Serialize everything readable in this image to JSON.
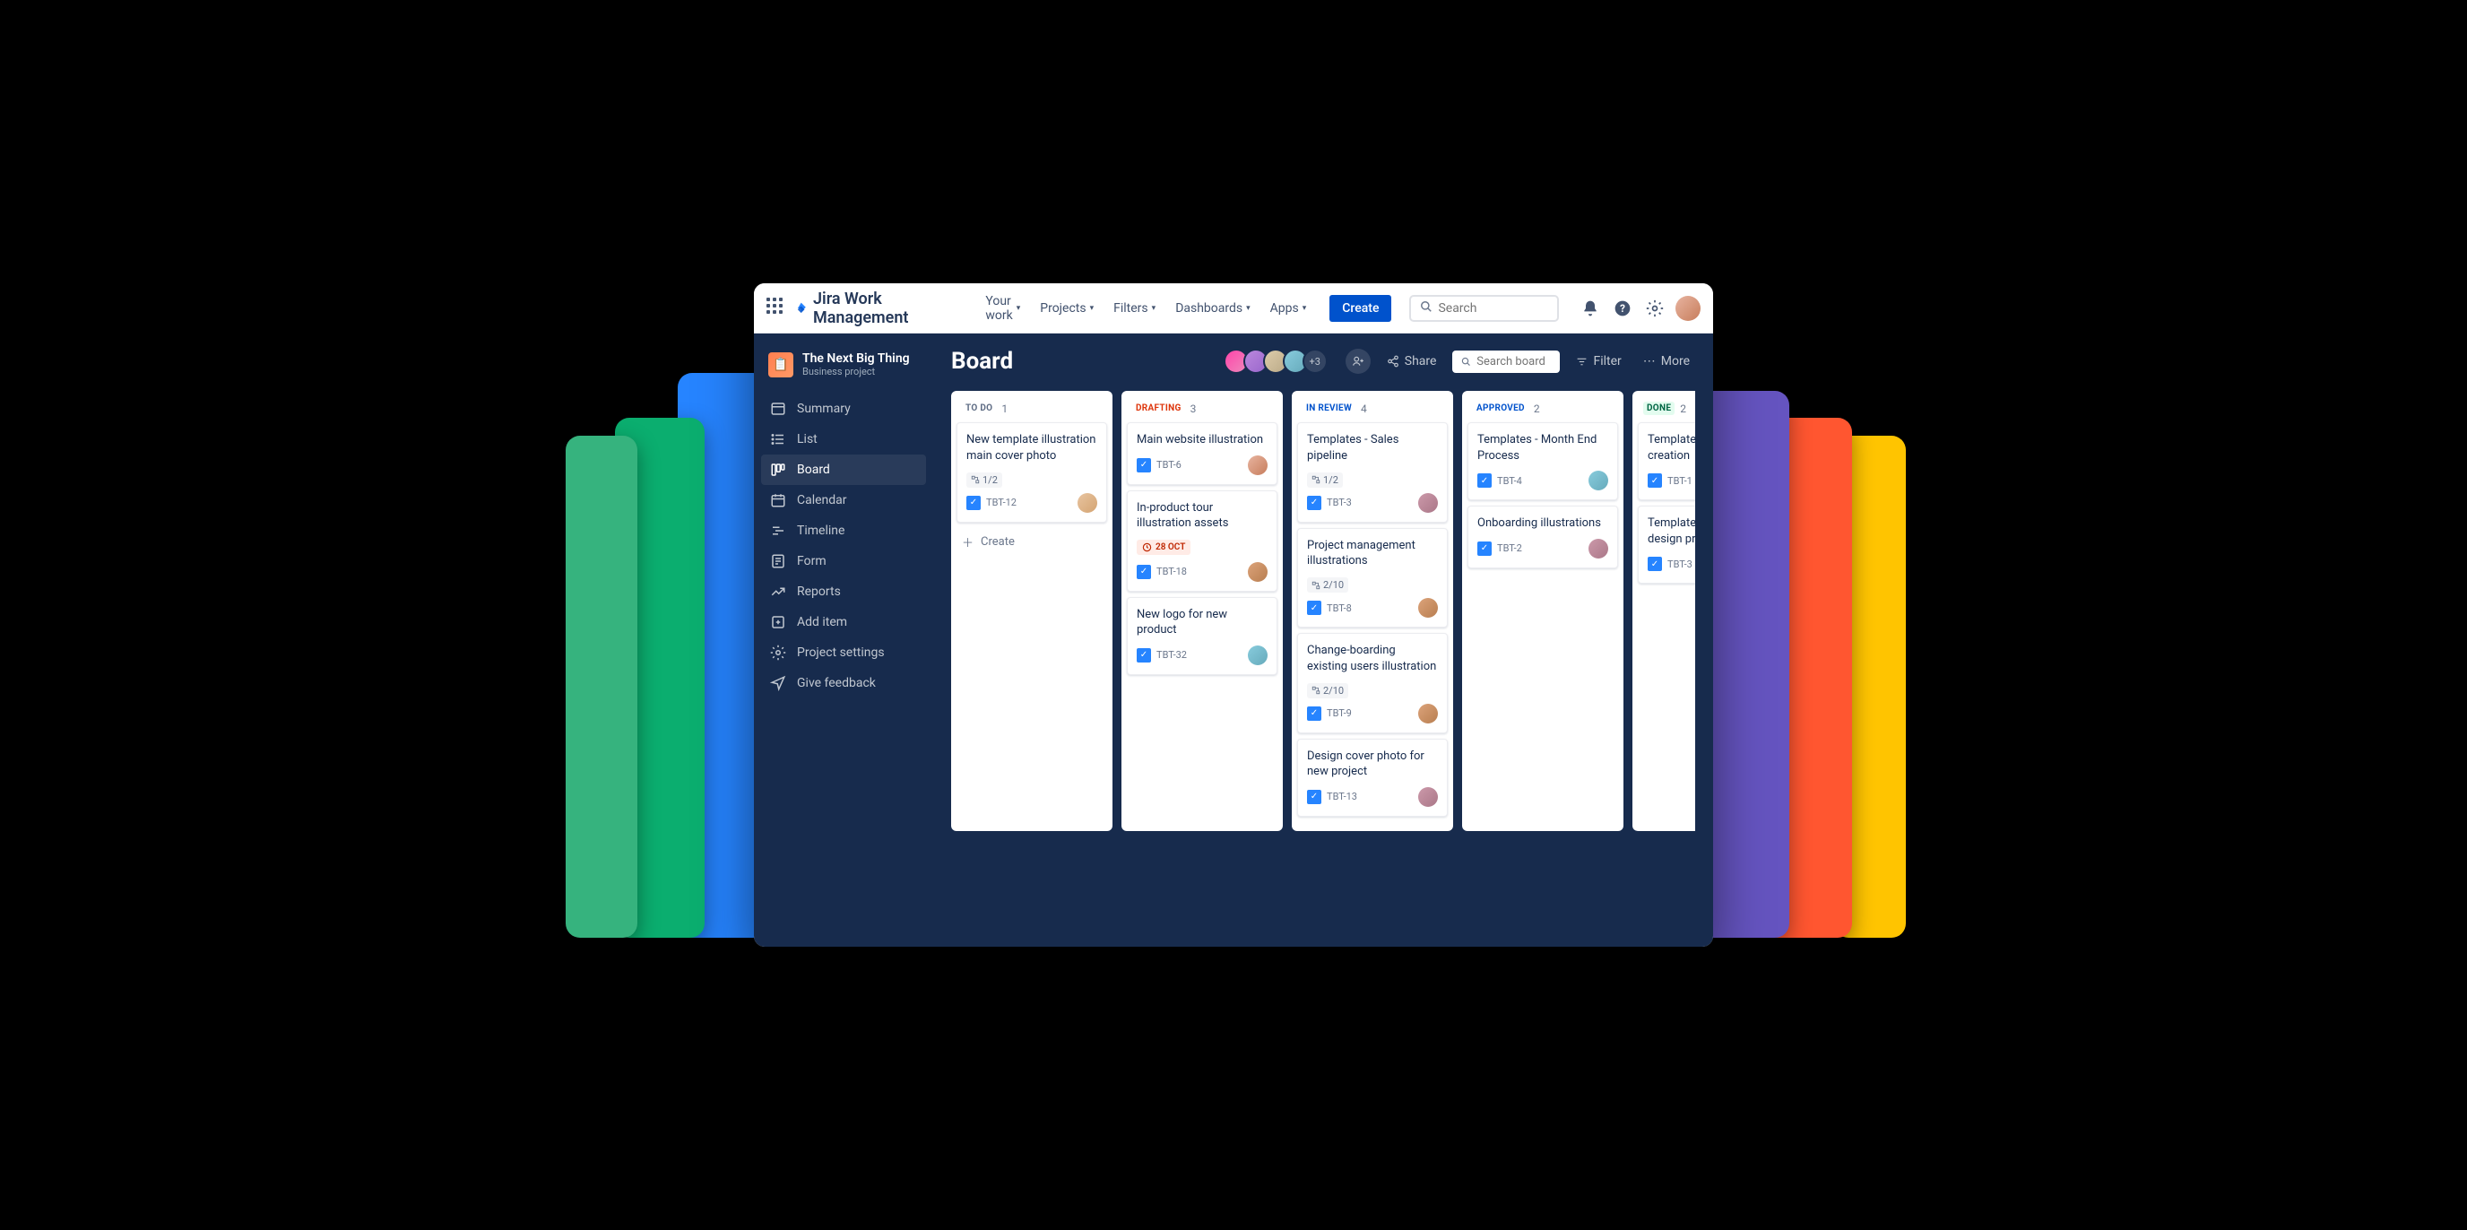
{
  "app_name": "Jira Work Management",
  "nav": {
    "items": [
      "Your work",
      "Projects",
      "Filters",
      "Dashboards",
      "Apps"
    ],
    "create": "Create",
    "search_placeholder": "Search"
  },
  "project": {
    "name": "The Next Big Thing",
    "type": "Business project"
  },
  "sidebar": {
    "items": [
      {
        "label": "Summary",
        "icon": "summary"
      },
      {
        "label": "List",
        "icon": "list"
      },
      {
        "label": "Board",
        "icon": "board",
        "active": true
      },
      {
        "label": "Calendar",
        "icon": "calendar"
      },
      {
        "label": "Timeline",
        "icon": "timeline"
      },
      {
        "label": "Form",
        "icon": "form"
      },
      {
        "label": "Reports",
        "icon": "reports"
      },
      {
        "label": "Add item",
        "icon": "add"
      },
      {
        "label": "Project settings",
        "icon": "settings"
      },
      {
        "label": "Give feedback",
        "icon": "feedback"
      }
    ]
  },
  "page": {
    "title": "Board",
    "avatar_overflow": "+3",
    "share": "Share",
    "search_placeholder": "Search board",
    "filter": "Filter",
    "more": "More"
  },
  "columns": [
    {
      "name": "TO DO",
      "count": "1",
      "class": "lbl-todo",
      "cards": [
        {
          "title": "New template illustration main cover photo",
          "key": "TBT-12",
          "sub": "1/2",
          "avatar": "a5"
        }
      ],
      "create": "Create"
    },
    {
      "name": "DRAFTING",
      "count": "3",
      "class": "lbl-draft",
      "cards": [
        {
          "title": "Main website illustration",
          "key": "TBT-6",
          "avatar": "a1"
        },
        {
          "title": "In-product tour illustration assets",
          "key": "TBT-18",
          "date": "28 OCT",
          "avatar": "a4"
        },
        {
          "title": "New logo for new product",
          "key": "TBT-32",
          "avatar": "a2"
        }
      ]
    },
    {
      "name": "IN REVIEW",
      "count": "4",
      "class": "lbl-review",
      "cards": [
        {
          "title": "Templates - Sales pipeline",
          "key": "TBT-3",
          "sub": "1/2",
          "avatar": "a3"
        },
        {
          "title": "Project management illustrations",
          "key": "TBT-8",
          "sub": "2/10",
          "avatar": "a4"
        },
        {
          "title": "Change-boarding existing users illustration",
          "key": "TBT-9",
          "sub": "2/10",
          "avatar": "a4"
        },
        {
          "title": "Design cover photo for new project",
          "key": "TBT-13",
          "avatar": "a3"
        }
      ]
    },
    {
      "name": "APPROVED",
      "count": "2",
      "class": "lbl-approved",
      "cards": [
        {
          "title": "Templates - Month End Process",
          "key": "TBT-4",
          "avatar": "a2"
        },
        {
          "title": "Onboarding illustrations",
          "key": "TBT-2",
          "avatar": "a3"
        }
      ]
    },
    {
      "name": "DONE",
      "count": "2",
      "class": "lbl-done",
      "cards": [
        {
          "title": "Templates - Asset creation",
          "key": "TBT-1",
          "avatar": "a2"
        },
        {
          "title": "Templates - Website design process",
          "key": "TBT-3",
          "avatar": "a4"
        }
      ]
    }
  ]
}
